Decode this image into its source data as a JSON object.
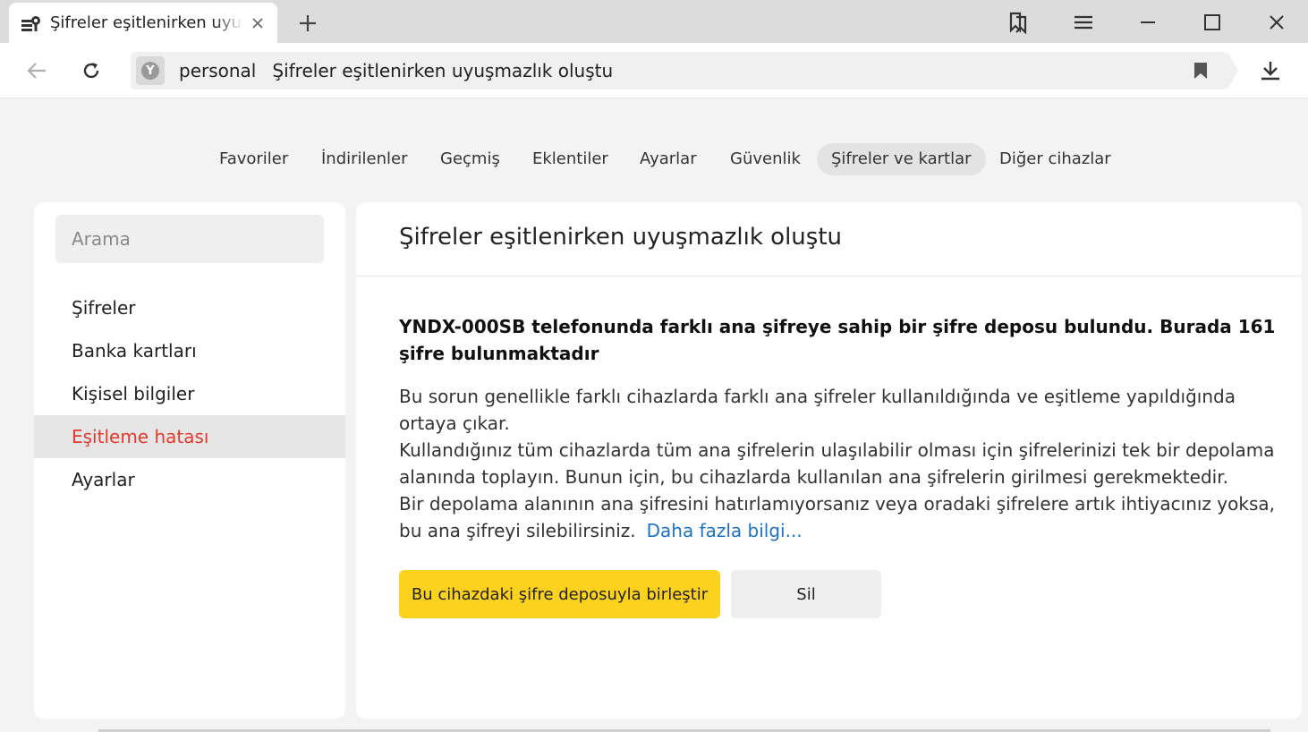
{
  "tab": {
    "title": "Şifreler eşitlenirken uyuşmazlık oluştu",
    "icon": "key-icon"
  },
  "window": {
    "new_tab_icon": "plus-icon",
    "collections_icon": "bookmarks-collection-icon",
    "menu_icon": "hamburger-menu-icon",
    "minimize_icon": "minimize-icon",
    "maximize_icon": "maximize-icon",
    "close_icon": "close-icon"
  },
  "addressbar": {
    "host": "personal",
    "page_title": "Şifreler eşitlenirken uyuşmazlık oluştu",
    "site_icon_letter": "Y"
  },
  "nav": {
    "items": [
      {
        "label": "Favoriler"
      },
      {
        "label": "İndirilenler"
      },
      {
        "label": "Geçmiş"
      },
      {
        "label": "Eklentiler"
      },
      {
        "label": "Ayarlar"
      },
      {
        "label": "Güvenlik"
      },
      {
        "label": "Şifreler ve kartlar",
        "active": true
      },
      {
        "label": "Diğer cihazlar"
      }
    ]
  },
  "sidebar": {
    "search_placeholder": "Arama",
    "items": [
      {
        "label": "Şifreler"
      },
      {
        "label": "Banka kartları"
      },
      {
        "label": "Kişisel bilgiler"
      },
      {
        "label": "Eşitleme hatası",
        "active": true
      },
      {
        "label": "Ayarlar"
      }
    ]
  },
  "main": {
    "title": "Şifreler eşitlenirken uyuşmazlık oluştu",
    "headline": "YNDX-000SB telefonunda farklı ana şifreye sahip bir şifre deposu bulundu. Burada 161 şifre bulunmaktadır",
    "paragraph1": "Bu sorun genellikle farklı cihazlarda farklı ana şifreler kullanıldığında ve eşitleme yapıldığında ortaya çıkar.",
    "paragraph2": "Kullandığınız tüm cihazlarda tüm ana şifrelerin ulaşılabilir olması için şifrelerinizi tek bir depolama alanında toplayın. Bunun için, bu cihazlarda kullanılan ana şifrelerin girilmesi gerekmektedir.",
    "paragraph3": "Bir depolama alanının ana şifresini hatırlamıyorsanız veya oradaki şifrelere artık ihtiyacınız yoksa, bu ana şifreyi silebilirsiniz.",
    "more_link": "Daha fazla bilgi...",
    "merge_button": "Bu cihazdaki şifre deposuyla birleştir",
    "delete_button": "Sil"
  },
  "colors": {
    "accent_yellow": "#fcd21e",
    "active_red": "#e23a2e",
    "link_blue": "#1a73c8"
  }
}
